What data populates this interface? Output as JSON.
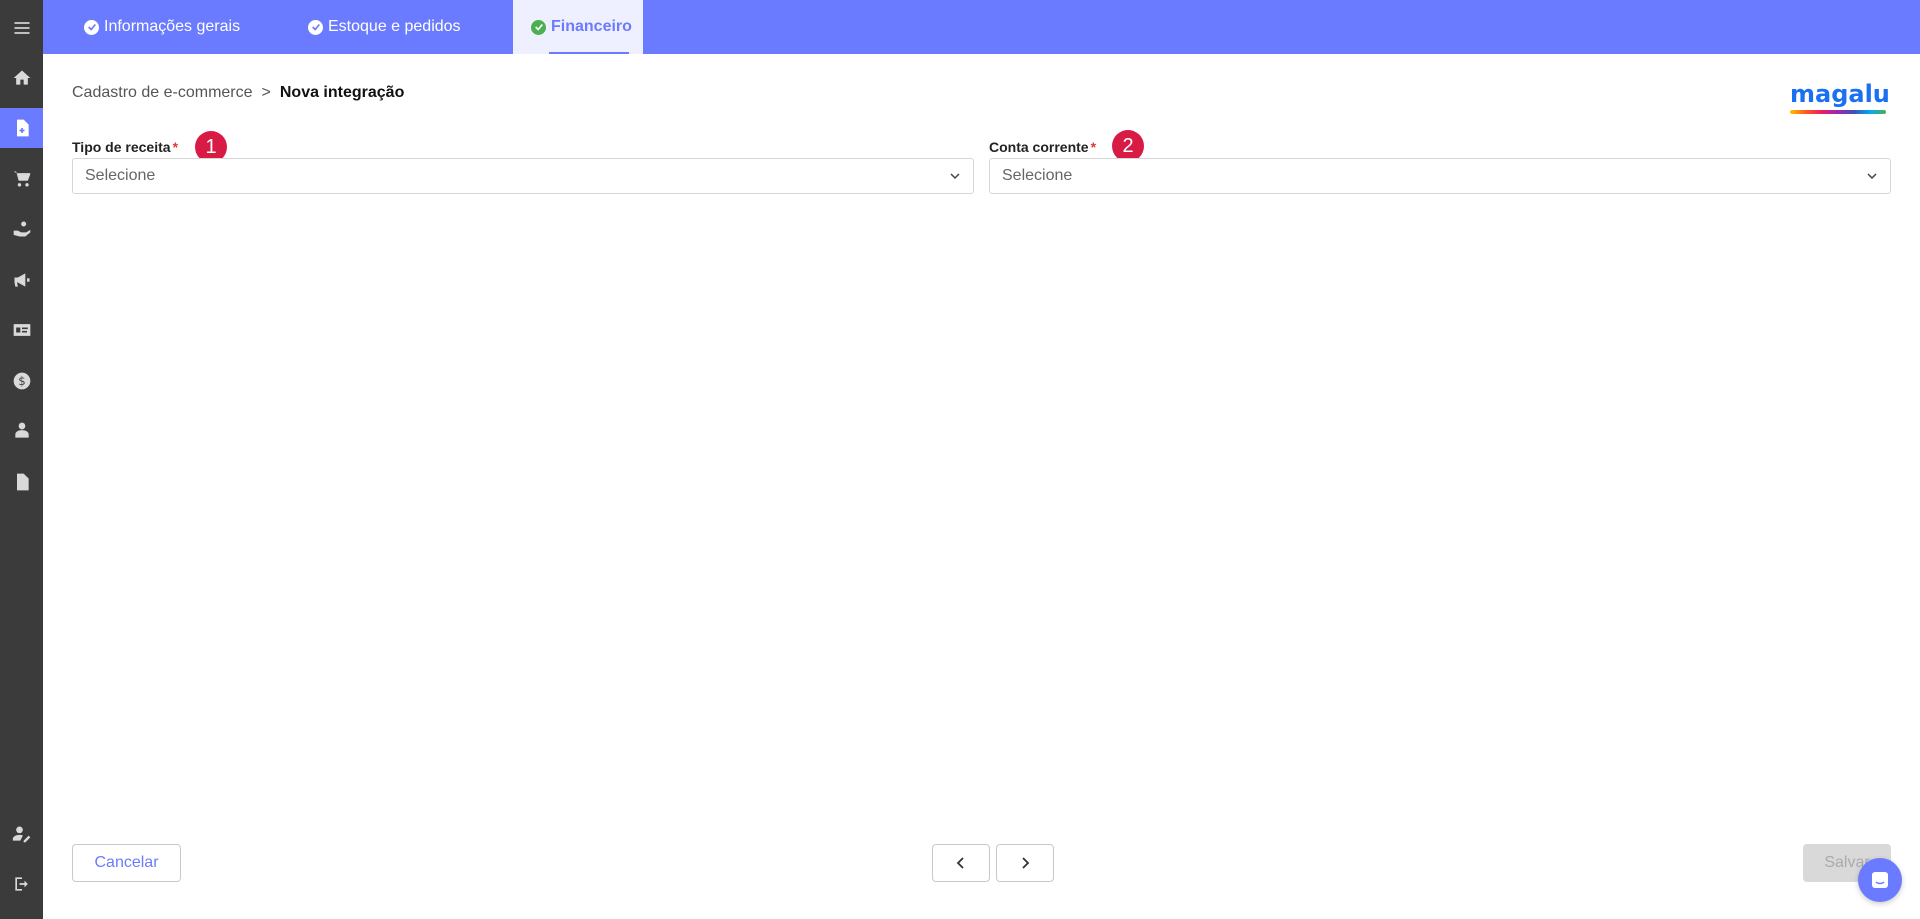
{
  "sidebar": {
    "items": [
      {
        "name": "menu",
        "icon": "hamburger-icon"
      },
      {
        "name": "home",
        "icon": "home-icon"
      },
      {
        "name": "document",
        "icon": "document-plus-icon",
        "active": true
      },
      {
        "name": "cart",
        "icon": "cart-icon"
      },
      {
        "name": "hand-coin",
        "icon": "hand-coin-icon"
      },
      {
        "name": "megaphone",
        "icon": "megaphone-icon"
      },
      {
        "name": "id-card",
        "icon": "id-card-icon"
      },
      {
        "name": "dollar",
        "icon": "dollar-icon"
      },
      {
        "name": "person-desk",
        "icon": "person-desk-icon"
      },
      {
        "name": "file",
        "icon": "file-icon"
      },
      {
        "name": "user-edit",
        "icon": "user-edit-icon"
      },
      {
        "name": "logout",
        "icon": "logout-icon"
      }
    ]
  },
  "tabs": [
    {
      "label": "Informações gerais",
      "state": "completed"
    },
    {
      "label": "Estoque e pedidos",
      "state": "completed"
    },
    {
      "label": "Financeiro",
      "state": "active"
    }
  ],
  "breadcrumb": {
    "parent": "Cadastro de e-commerce",
    "separator": ">",
    "current": "Nova integração"
  },
  "logo": {
    "text": "magalu"
  },
  "form": {
    "revenue_type": {
      "label": "Tipo de receita",
      "required_mark": "*",
      "placeholder": "Selecione",
      "marker": "1"
    },
    "checking_account": {
      "label": "Conta corrente",
      "required_mark": "*",
      "placeholder": "Selecione",
      "marker": "2"
    }
  },
  "footer": {
    "cancel_label": "Cancelar",
    "save_label": "Salvar"
  },
  "colors": {
    "accent": "#6b7bff",
    "sidebar": "#3b3b3b",
    "marker": "#d81b45",
    "completed": "#4caf50"
  }
}
